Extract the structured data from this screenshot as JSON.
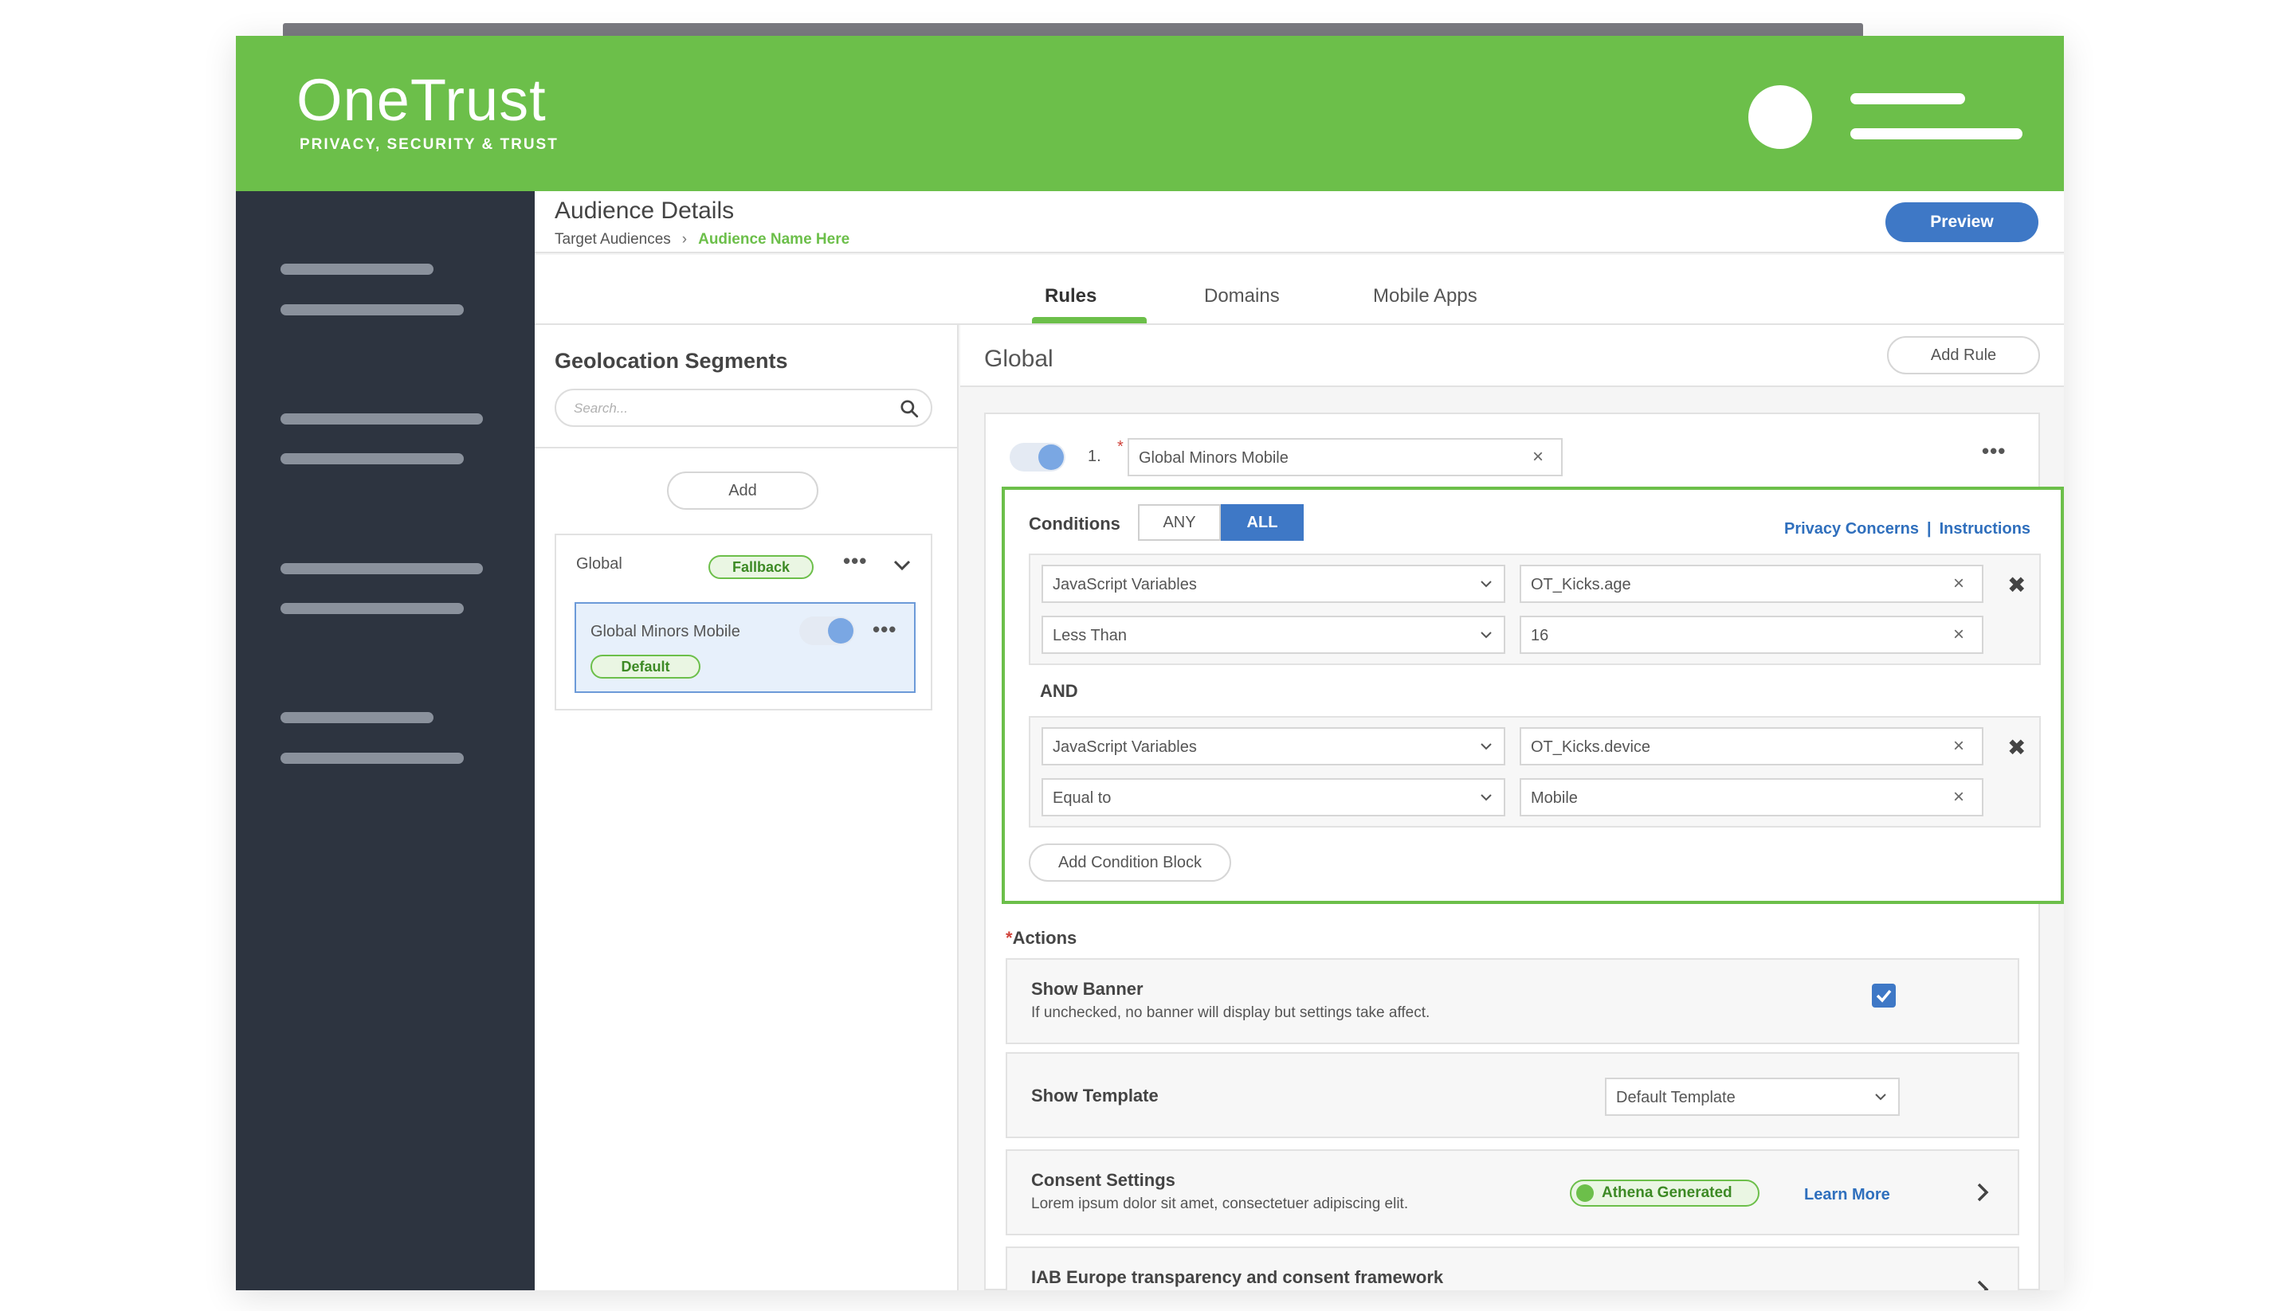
{
  "brand": {
    "name": "OneTrust",
    "tagline": "PRIVACY, SECURITY & TRUST",
    "accent": "#6cbf4a",
    "primary_blue": "#3e78c6",
    "sidebar_bg": "#2d3440"
  },
  "page": {
    "title": "Audience Details",
    "breadcrumb": [
      "Target Audiences",
      "Audience Name Here"
    ],
    "preview_label": "Preview"
  },
  "tabs": [
    {
      "label": "Rules",
      "active": true
    },
    {
      "label": "Domains",
      "active": false
    },
    {
      "label": "Mobile Apps",
      "active": false
    }
  ],
  "segments": {
    "title": "Geolocation Segments",
    "search_placeholder": "Search...",
    "add_label": "Add",
    "group": {
      "name": "Global",
      "badge": "Fallback",
      "child": {
        "name": "Global Minors Mobile",
        "badge": "Default",
        "enabled": true
      }
    }
  },
  "rules": {
    "title": "Global",
    "add_rule_label": "Add Rule",
    "rule": {
      "number": "1.",
      "name": "Global Minors Mobile",
      "enabled": true
    }
  },
  "conditions": {
    "label": "Conditions",
    "any_label": "ANY",
    "all_label": "ALL",
    "selected": "ALL",
    "links": [
      "Privacy Concerns",
      "Instructions"
    ],
    "join_label": "AND",
    "blocks": [
      {
        "variable_type": "JavaScript Variables",
        "variable": "OT_Kicks.age",
        "operator": "Less Than",
        "value": "16"
      },
      {
        "variable_type": "JavaScript Variables",
        "variable": "OT_Kicks.device",
        "operator": "Equal to",
        "value": "Mobile"
      }
    ],
    "add_block_label": "Add Condition Block"
  },
  "actions": {
    "label": "Actions",
    "show_banner": {
      "title": "Show Banner",
      "desc": "If unchecked, no banner will display but settings take affect.",
      "checked": true
    },
    "show_template": {
      "title": "Show Template",
      "value": "Default Template"
    },
    "consent_settings": {
      "title": "Consent Settings",
      "desc": "Lorem ipsum dolor sit amet, consectetuer adipiscing elit.",
      "badge": "Athena Generated",
      "link": "Learn More"
    },
    "iab": {
      "title": "IAB Europe transparency and consent framework"
    }
  }
}
